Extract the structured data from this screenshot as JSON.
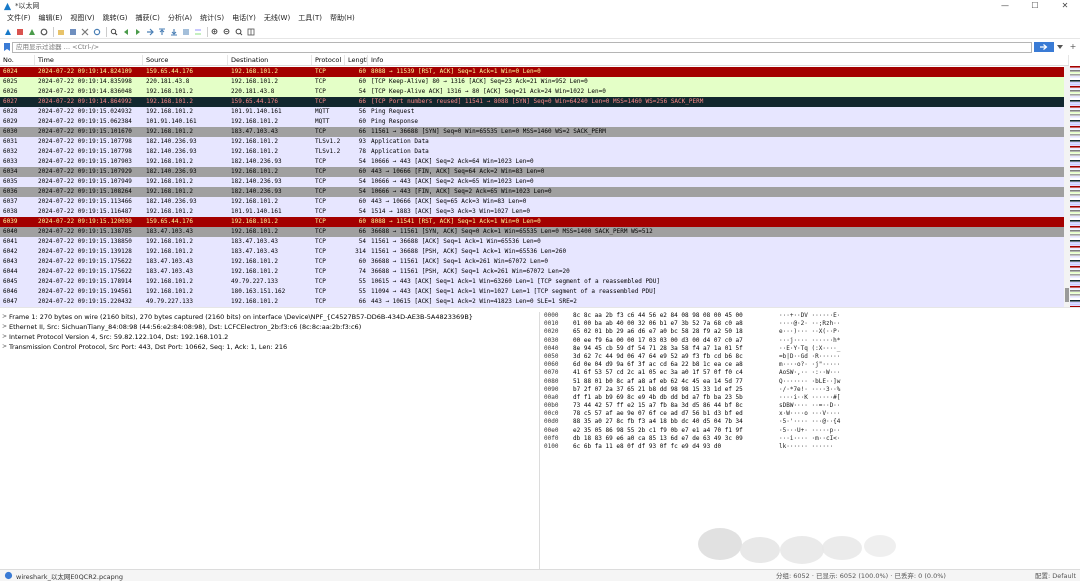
{
  "window": {
    "title": "*以太网"
  },
  "menu": [
    "文件(F)",
    "编辑(E)",
    "视图(V)",
    "跳转(G)",
    "捕获(C)",
    "分析(A)",
    "统计(S)",
    "电话(Y)",
    "无线(W)",
    "工具(T)",
    "帮助(H)"
  ],
  "filter": {
    "placeholder": "应用显示过滤器 … <Ctrl-/>",
    "add": "+"
  },
  "columns": [
    "No.",
    "Time",
    "Source",
    "Destination",
    "Protocol",
    "Length",
    "Info"
  ],
  "colors": {
    "red": "#a40000",
    "red_text": "#fffc9c",
    "green": "#e4ffc7",
    "dark": "#12272e",
    "dark_text": "#f78787",
    "lavender": "#e7e6ff",
    "gray": "#a0a0a0"
  },
  "packets": [
    {
      "no": "6024",
      "time": "2024-07-22 09:19:14.824109",
      "src": "159.65.44.176",
      "dst": "192.168.101.2",
      "proto": "TCP",
      "len": "60",
      "info": "8088 → 11539 [RST, ACK] Seq=1 Ack=1 Win=0 Len=0",
      "style": "red"
    },
    {
      "no": "6025",
      "time": "2024-07-22 09:19:14.835998",
      "src": "220.181.43.8",
      "dst": "192.168.101.2",
      "proto": "TCP",
      "len": "60",
      "info": "[TCP Keep-Alive] 80 → 1316 [ACK] Seq=23 Ack=21 Win=952 Len=0",
      "style": "green"
    },
    {
      "no": "6026",
      "time": "2024-07-22 09:19:14.836048",
      "src": "192.168.101.2",
      "dst": "220.181.43.8",
      "proto": "TCP",
      "len": "54",
      "info": "[TCP Keep-Alive ACK] 1316 → 80 [ACK] Seq=21 Ack=24 Win=1022 Len=0",
      "style": "green"
    },
    {
      "no": "6027",
      "time": "2024-07-22 09:19:14.864992",
      "src": "192.168.101.2",
      "dst": "159.65.44.176",
      "proto": "TCP",
      "len": "66",
      "info": "[TCP Port numbers reused] 11541 → 8088 [SYN] Seq=0 Win=64240 Len=0 MSS=1460 WS=256 SACK_PERM",
      "style": "dark"
    },
    {
      "no": "6028",
      "time": "2024-07-22 09:19:15.024932",
      "src": "192.168.101.2",
      "dst": "101.91.140.161",
      "proto": "MQTT",
      "len": "56",
      "info": "Ping Request",
      "style": "lavender"
    },
    {
      "no": "6029",
      "time": "2024-07-22 09:19:15.062384",
      "src": "101.91.140.161",
      "dst": "192.168.101.2",
      "proto": "MQTT",
      "len": "60",
      "info": "Ping Response",
      "style": "lavender"
    },
    {
      "no": "6030",
      "time": "2024-07-22 09:19:15.101670",
      "src": "192.168.101.2",
      "dst": "183.47.103.43",
      "proto": "TCP",
      "len": "66",
      "info": "11561 → 36688 [SYN] Seq=0 Win=65535 Len=0 MSS=1460 WS=2 SACK_PERM",
      "style": "gray"
    },
    {
      "no": "6031",
      "time": "2024-07-22 09:19:15.107798",
      "src": "182.140.236.93",
      "dst": "192.168.101.2",
      "proto": "TLSv1.2",
      "len": "93",
      "info": "Application Data",
      "style": "lavender"
    },
    {
      "no": "6032",
      "time": "2024-07-22 09:19:15.107798",
      "src": "182.140.236.93",
      "dst": "192.168.101.2",
      "proto": "TLSv1.2",
      "len": "78",
      "info": "Application Data",
      "style": "lavender"
    },
    {
      "no": "6033",
      "time": "2024-07-22 09:19:15.107903",
      "src": "192.168.101.2",
      "dst": "182.140.236.93",
      "proto": "TCP",
      "len": "54",
      "info": "10666 → 443 [ACK] Seq=2 Ack=64 Win=1023 Len=0",
      "style": "lavender"
    },
    {
      "no": "6034",
      "time": "2024-07-22 09:19:15.107929",
      "src": "182.140.236.93",
      "dst": "192.168.101.2",
      "proto": "TCP",
      "len": "60",
      "info": "443 → 10666 [FIN, ACK] Seq=64 Ack=2 Win=83 Len=0",
      "style": "gray"
    },
    {
      "no": "6035",
      "time": "2024-07-22 09:19:15.107949",
      "src": "192.168.101.2",
      "dst": "182.140.236.93",
      "proto": "TCP",
      "len": "54",
      "info": "10666 → 443 [ACK] Seq=2 Ack=65 Win=1023 Len=0",
      "style": "lavender"
    },
    {
      "no": "6036",
      "time": "2024-07-22 09:19:15.108264",
      "src": "192.168.101.2",
      "dst": "182.140.236.93",
      "proto": "TCP",
      "len": "54",
      "info": "10666 → 443 [FIN, ACK] Seq=2 Ack=65 Win=1023 Len=0",
      "style": "gray"
    },
    {
      "no": "6037",
      "time": "2024-07-22 09:19:15.113466",
      "src": "182.140.236.93",
      "dst": "192.168.101.2",
      "proto": "TCP",
      "len": "60",
      "info": "443 → 10666 [ACK] Seq=65 Ack=3 Win=83 Len=0",
      "style": "lavender"
    },
    {
      "no": "6038",
      "time": "2024-07-22 09:19:15.116487",
      "src": "192.168.101.2",
      "dst": "101.91.140.161",
      "proto": "TCP",
      "len": "54",
      "info": "1514 → 1883 [ACK] Seq=3 Ack=3 Win=1027 Len=0",
      "style": "lavender"
    },
    {
      "no": "6039",
      "time": "2024-07-22 09:19:15.120030",
      "src": "159.65.44.176",
      "dst": "192.168.101.2",
      "proto": "TCP",
      "len": "60",
      "info": "8088 → 11541 [RST, ACK] Seq=1 Ack=1 Win=0 Len=0",
      "style": "red"
    },
    {
      "no": "6040",
      "time": "2024-07-22 09:19:15.138785",
      "src": "183.47.103.43",
      "dst": "192.168.101.2",
      "proto": "TCP",
      "len": "66",
      "info": "36688 → 11561 [SYN, ACK] Seq=0 Ack=1 Win=65535 Len=0 MSS=1400 SACK_PERM WS=512",
      "style": "gray"
    },
    {
      "no": "6041",
      "time": "2024-07-22 09:19:15.138850",
      "src": "192.168.101.2",
      "dst": "183.47.103.43",
      "proto": "TCP",
      "len": "54",
      "info": "11561 → 36688 [ACK] Seq=1 Ack=1 Win=65536 Len=0",
      "style": "lavender"
    },
    {
      "no": "6042",
      "time": "2024-07-22 09:19:15.139128",
      "src": "192.168.101.2",
      "dst": "183.47.103.43",
      "proto": "TCP",
      "len": "314",
      "info": "11561 → 36688 [PSH, ACK] Seq=1 Ack=1 Win=65536 Len=260",
      "style": "lavender"
    },
    {
      "no": "6043",
      "time": "2024-07-22 09:19:15.175622",
      "src": "183.47.103.43",
      "dst": "192.168.101.2",
      "proto": "TCP",
      "len": "60",
      "info": "36688 → 11561 [ACK] Seq=1 Ack=261 Win=67072 Len=0",
      "style": "lavender"
    },
    {
      "no": "6044",
      "time": "2024-07-22 09:19:15.175622",
      "src": "183.47.103.43",
      "dst": "192.168.101.2",
      "proto": "TCP",
      "len": "74",
      "info": "36688 → 11561 [PSH, ACK] Seq=1 Ack=261 Win=67072 Len=20",
      "style": "lavender"
    },
    {
      "no": "6045",
      "time": "2024-07-22 09:19:15.178914",
      "src": "192.168.101.2",
      "dst": "49.79.227.133",
      "proto": "TCP",
      "len": "55",
      "info": "10615 → 443 [ACK] Seq=1 Ack=1 Win=63260 Len=1 [TCP segment of a reassembled PDU]",
      "style": "lavender"
    },
    {
      "no": "6046",
      "time": "2024-07-22 09:19:15.194561",
      "src": "192.168.101.2",
      "dst": "180.163.151.162",
      "proto": "TCP",
      "len": "55",
      "info": "11094 → 443 [ACK] Seq=1 Ack=1 Win=1027 Len=1 [TCP segment of a reassembled PDU]",
      "style": "lavender"
    },
    {
      "no": "6047",
      "time": "2024-07-22 09:19:15.220432",
      "src": "49.79.227.133",
      "dst": "192.168.101.2",
      "proto": "TCP",
      "len": "66",
      "info": "443 → 10615 [ACK] Seq=1 Ack=2 Win=41823 Len=0 SLE=1 SRE=2",
      "style": "lavender"
    }
  ],
  "details": [
    "Frame 1: 270 bytes on wire (2160 bits), 270 bytes captured (2160 bits) on interface \\Device\\NPF_{C4527B57-DD6B-434D-AE3B-5A4823369B}",
    "Ethernet II, Src: SichuanTiany_84:08:98 (44:56:e2:84:08:98), Dst: LCFCElectron_2b:f3:c6 (8c:8c:aa:2b:f3:c6)",
    "Internet Protocol Version 4, Src: 59.82.122.104, Dst: 192.168.101.2",
    "Transmission Control Protocol, Src Port: 443, Dst Port: 10662, Seq: 1, Ack: 1, Len: 216"
  ],
  "hex": [
    {
      "off": "0000",
      "bytes": "8c 8c aa 2b f3 c6 44 56  e2 84 08 98 08 00 45 00",
      "ascii": "···+··DV ······E·"
    },
    {
      "off": "0010",
      "bytes": "01 00 ba ab 40 00 32 06  b1 e7 3b 52 7a 68 c0 a8",
      "ascii": "····@·2· ··;Rzh··"
    },
    {
      "off": "0020",
      "bytes": "65 02 01 bb 29 a6 d6 e7  a0 bc 58 28 f9 a2 50 18",
      "ascii": "e···)··· ··X(··P·"
    },
    {
      "off": "0030",
      "bytes": "00 ee f9 6a 00 00 17 03  03 00 d3 00 d4 07 c0 a7",
      "ascii": "···j···· ······h*"
    },
    {
      "off": "0040",
      "bytes": "8e 94 45 cb 59 df 54 71  28 3a 58 f4 a7 1a 01 5f",
      "ascii": "··E·Y·Tq (:X····_"
    },
    {
      "off": "0050",
      "bytes": "3d 62 7c 44 9d 06 47 64  e9 52 a9 f3 fb cd b6 8c",
      "ascii": "=b|D··Gd ·R······"
    },
    {
      "off": "0060",
      "bytes": "6d 0e 04 d9 9a 6f 3f ac  cd 6a 22 b8 1c ea ce a8",
      "ascii": "m····o?· ·j\"·····"
    },
    {
      "off": "0070",
      "bytes": "41 6f 53 57 cd 2c a1 05  ec 3a a0 1f 57 0f f0 c4",
      "ascii": "AoSW·,·· ·:··W···"
    },
    {
      "off": "0080",
      "bytes": "51 88 01 b0 8c af a8 af  eb 62 4c 45 ea 14 5d 77",
      "ascii": "Q······· ·bLE··]w"
    },
    {
      "off": "0090",
      "bytes": "b7 2f 07 2a 37 65 21 b8  dd 98 98 15 33 1d ef 25",
      "ascii": "·/·*7e!· ····3··%"
    },
    {
      "off": "00a0",
      "bytes": "df f1 ab b9 69 8c e9 4b  db dd bd a7 fb ba 23 5b",
      "ascii": "····i··K ······#["
    },
    {
      "off": "00b0",
      "bytes": "73 44 42 57 ff e2 15 a7  fb 8a 3d d5 86 44 bf 8c",
      "ascii": "sDBW···· ··=··D··"
    },
    {
      "off": "00c0",
      "bytes": "78 c5 57 af ae 9e 07 6f  ce ad d7 56 b1 d3 bf ed",
      "ascii": "x·W····o ···V····"
    },
    {
      "off": "00d0",
      "bytes": "88 35 a0 27 8c fb f3 a4  18 bb dc 40 d5 04 7b 34",
      "ascii": "·5·'···· ···@··{4"
    },
    {
      "off": "00e0",
      "bytes": "e2 35 05 86 98 55 2b c1  f9 0b e7 e1 a4 70 f1 9f",
      "ascii": "·5···U+· ·····p··"
    },
    {
      "off": "00f0",
      "bytes": "db 18 83 69 e6 a0 ca 85  13 6d e7 de 63 49 3c 09",
      "ascii": "···i···· ·m··cI<·"
    },
    {
      "off": "0100",
      "bytes": "6c 6b fa 11 e8 0f df 93  0f fc e9 d4 93 d0",
      "ascii": "lk······ ······"
    }
  ],
  "status": {
    "file": "wireshark_以太网E0QCR2.pcapng",
    "stats": "分组: 6052 · 已显示: 6052 (100.0%) · 已丢弃: 0 (0.0%)",
    "profile": "配置: Default"
  }
}
